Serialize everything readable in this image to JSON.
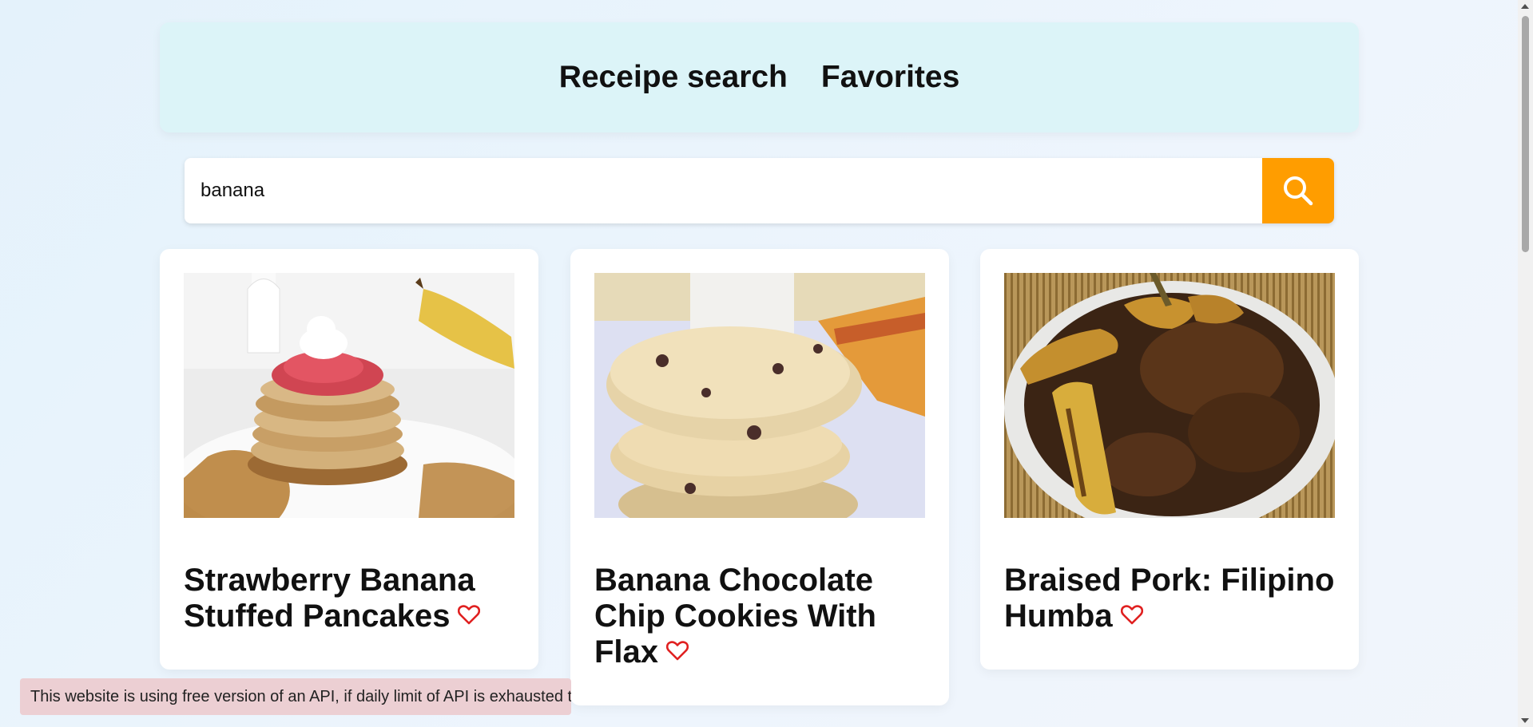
{
  "nav": {
    "items": [
      {
        "label": "Receipe search"
      },
      {
        "label": "Favorites"
      }
    ]
  },
  "search": {
    "value": "banana",
    "button_icon": "search-icon",
    "button_color": "#ff9d00"
  },
  "recipes": [
    {
      "title": "Strawberry Banana Stuffed Pancakes",
      "image": "pancakes-photo",
      "favorite": false
    },
    {
      "title": "Banana Chocolate Chip Cookies With Flax",
      "image": "cookies-photo",
      "favorite": false
    },
    {
      "title": "Braised Pork: Filipino Humba",
      "image": "pork-humba-photo",
      "favorite": false
    }
  ],
  "notice": {
    "text": "This website is using free version of an API, if daily limit of API is exhausted t"
  },
  "colors": {
    "accent": "#ff9d00",
    "heart": "#e02020",
    "nav_bg": "#dcf4f8",
    "notice_bg": "#eccfd3"
  }
}
